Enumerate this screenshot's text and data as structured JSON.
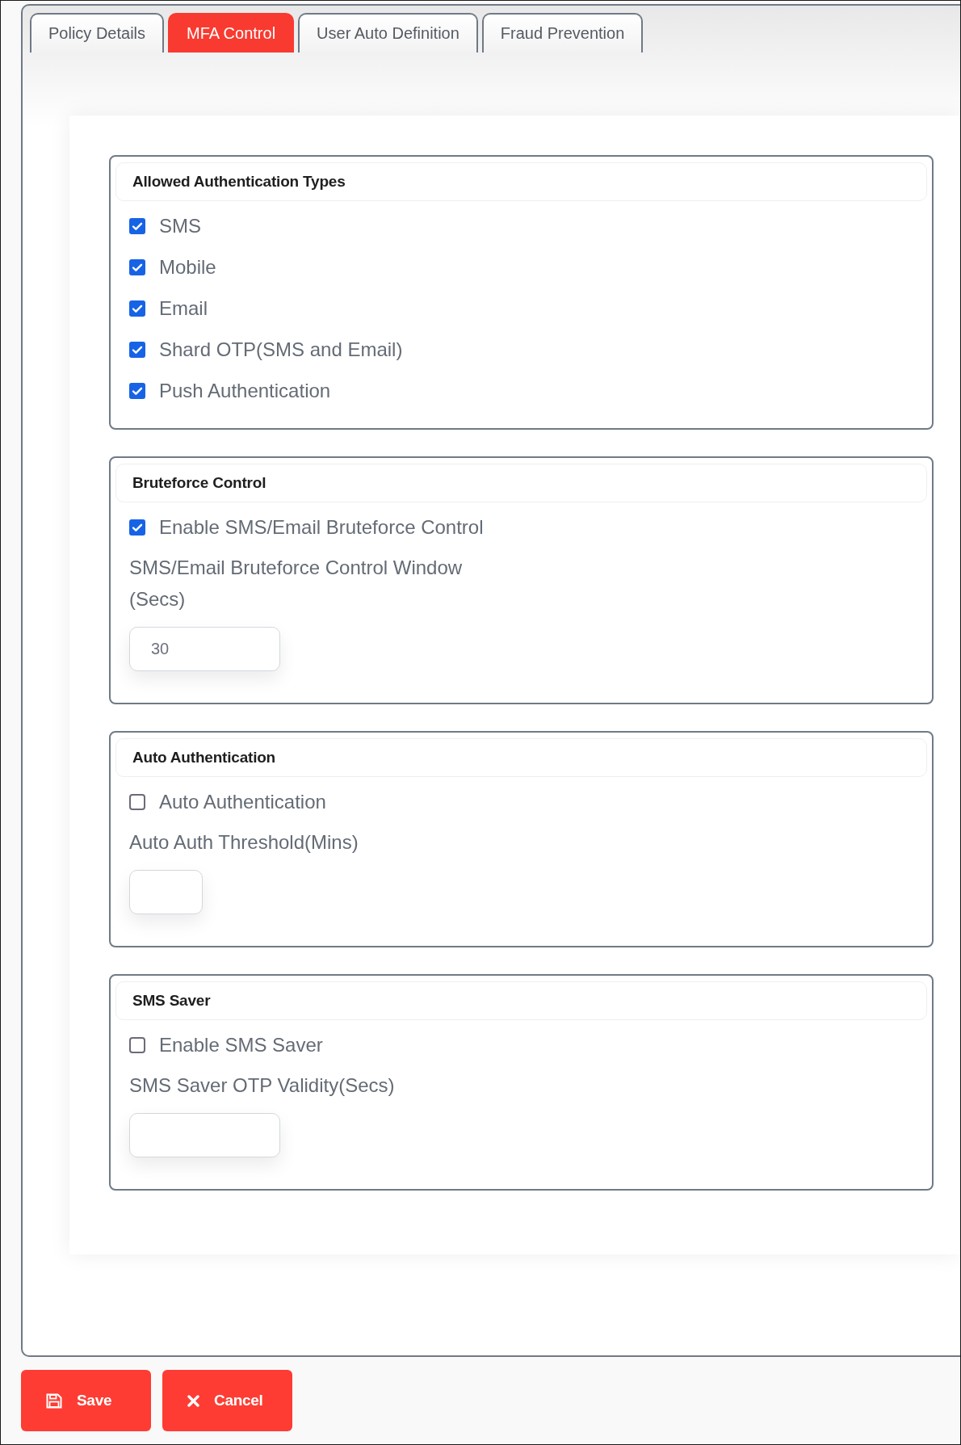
{
  "tabs": [
    {
      "label": "Policy Details",
      "selected": false
    },
    {
      "label": "MFA Control",
      "selected": true
    },
    {
      "label": "User Auto Definition",
      "selected": false
    },
    {
      "label": "Fraud Prevention",
      "selected": false
    }
  ],
  "sections": [
    {
      "title": "Allowed Authentication Types",
      "options": [
        {
          "label": "SMS",
          "checked": true
        },
        {
          "label": "Mobile",
          "checked": true
        },
        {
          "label": "Email",
          "checked": true
        },
        {
          "label": "Shard OTP(SMS and Email)",
          "checked": true
        },
        {
          "label": "Push Authentication",
          "checked": true
        }
      ]
    },
    {
      "title": "Bruteforce Control",
      "options": [
        {
          "label": "Enable SMS/Email Bruteforce Control",
          "checked": true
        }
      ],
      "field": {
        "label": "SMS/Email Bruteforce Control Window (Secs)",
        "value": "30"
      }
    },
    {
      "title": "Auto Authentication",
      "options": [
        {
          "label": "Auto Authentication",
          "checked": false
        }
      ],
      "field": {
        "label": "Auto Auth Threshold(Mins)"
      }
    },
    {
      "title": "SMS Saver",
      "options": [
        {
          "label": "Enable SMS Saver",
          "checked": false
        }
      ],
      "field": {
        "label": "SMS Saver OTP Validity(Secs)"
      }
    }
  ],
  "buttons": [
    {
      "label": "Save",
      "kind": "save"
    },
    {
      "label": "Cancel",
      "kind": "cancel"
    }
  ]
}
